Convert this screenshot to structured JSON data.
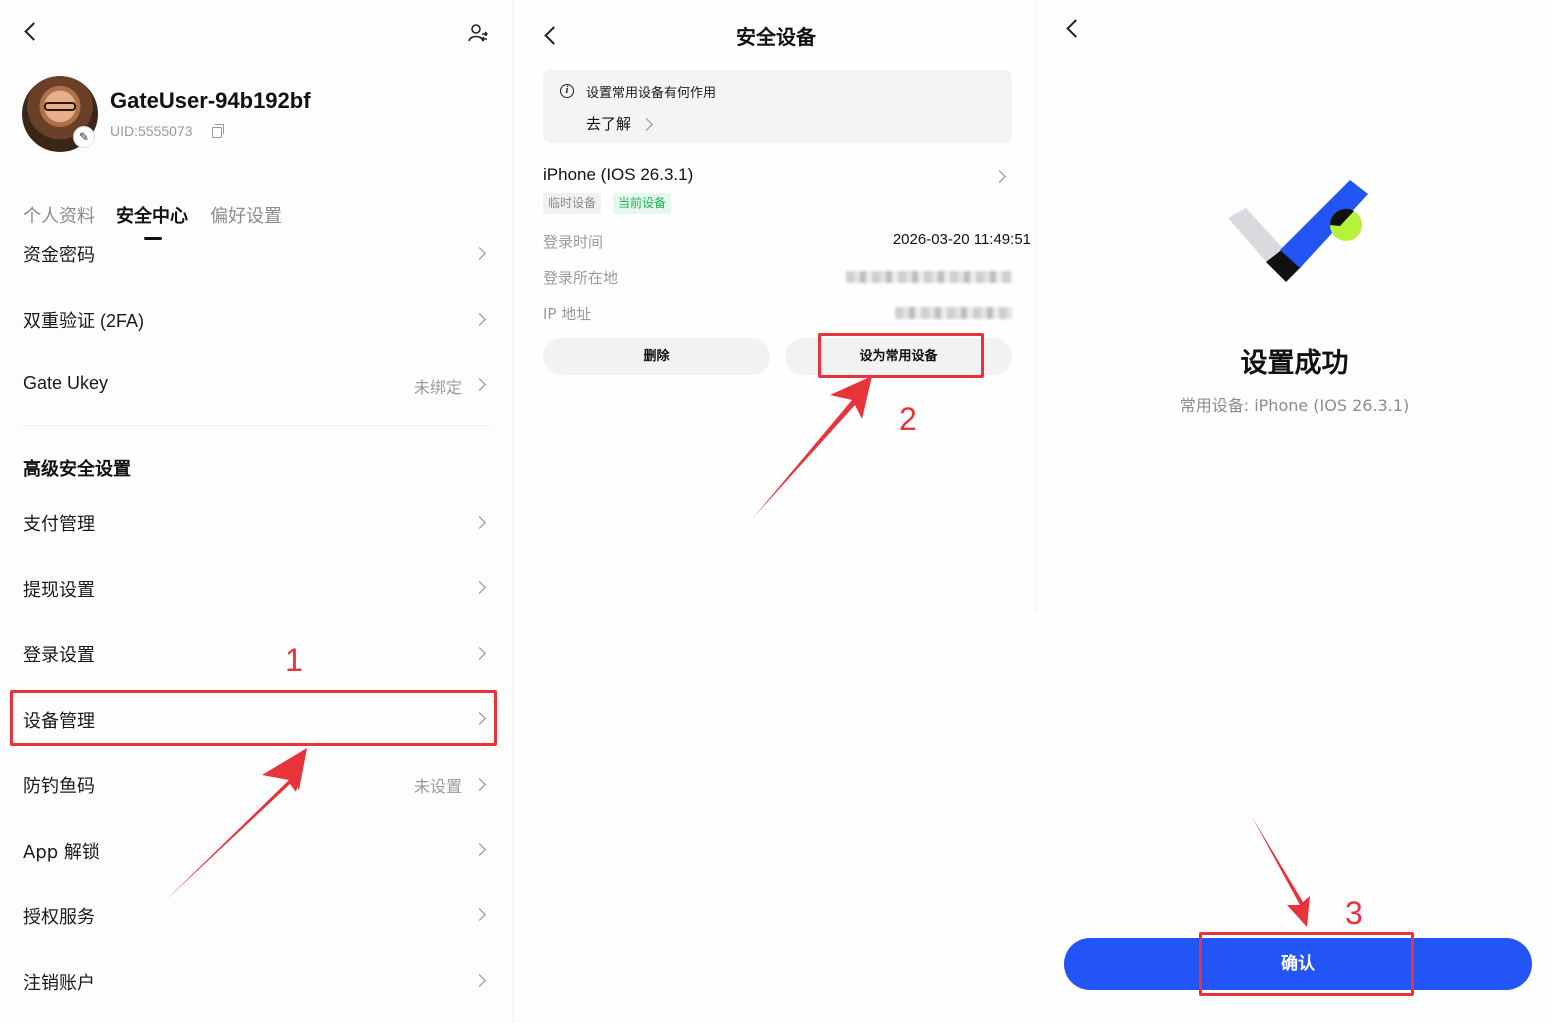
{
  "panel1": {
    "user": {
      "name": "GateUser-94b192bf",
      "uid": "UID:5555073"
    },
    "tabs": [
      {
        "label": "个人资料"
      },
      {
        "label": "安全中心"
      },
      {
        "label": "偏好设置"
      }
    ],
    "rows": [
      {
        "label": "资金密码",
        "value": ""
      },
      {
        "label": "双重验证 (2FA)",
        "value": ""
      },
      {
        "label": "Gate Ukey",
        "value": "未绑定"
      }
    ],
    "advanced_title": "高级安全设置",
    "advanced_rows": [
      {
        "label": "支付管理",
        "value": ""
      },
      {
        "label": "提现设置",
        "value": ""
      },
      {
        "label": "登录设置",
        "value": ""
      },
      {
        "label": "设备管理",
        "value": ""
      },
      {
        "label": "防钓鱼码",
        "value": "未设置"
      },
      {
        "label": "App 解锁",
        "value": ""
      },
      {
        "label": "授权服务",
        "value": ""
      },
      {
        "label": "注销账户",
        "value": ""
      }
    ]
  },
  "panel2": {
    "title": "安全设备",
    "info_text": "设置常用设备有何作用",
    "info_link": "去了解",
    "device": {
      "name": "iPhone (IOS 26.3.1)",
      "tag_temp": "临时设备",
      "tag_current": "当前设备",
      "login_time_label": "登录时间",
      "login_time": "2026-03-20 11:49:51",
      "location_label": "登录所在地",
      "ip_label": "IP 地址"
    },
    "delete_label": "删除",
    "set_common_label": "设为常用设备"
  },
  "panel3": {
    "title": "设置成功",
    "subtitle": "常用设备:  iPhone (IOS 26.3.1)",
    "confirm_label": "确认"
  },
  "annotations": {
    "step1": "1",
    "step2": "2",
    "step3": "3"
  },
  "colors": {
    "primary": "#2354f5",
    "annotation": "#e8333a",
    "success_green": "#20b25a",
    "lime": "#b6f23a"
  }
}
